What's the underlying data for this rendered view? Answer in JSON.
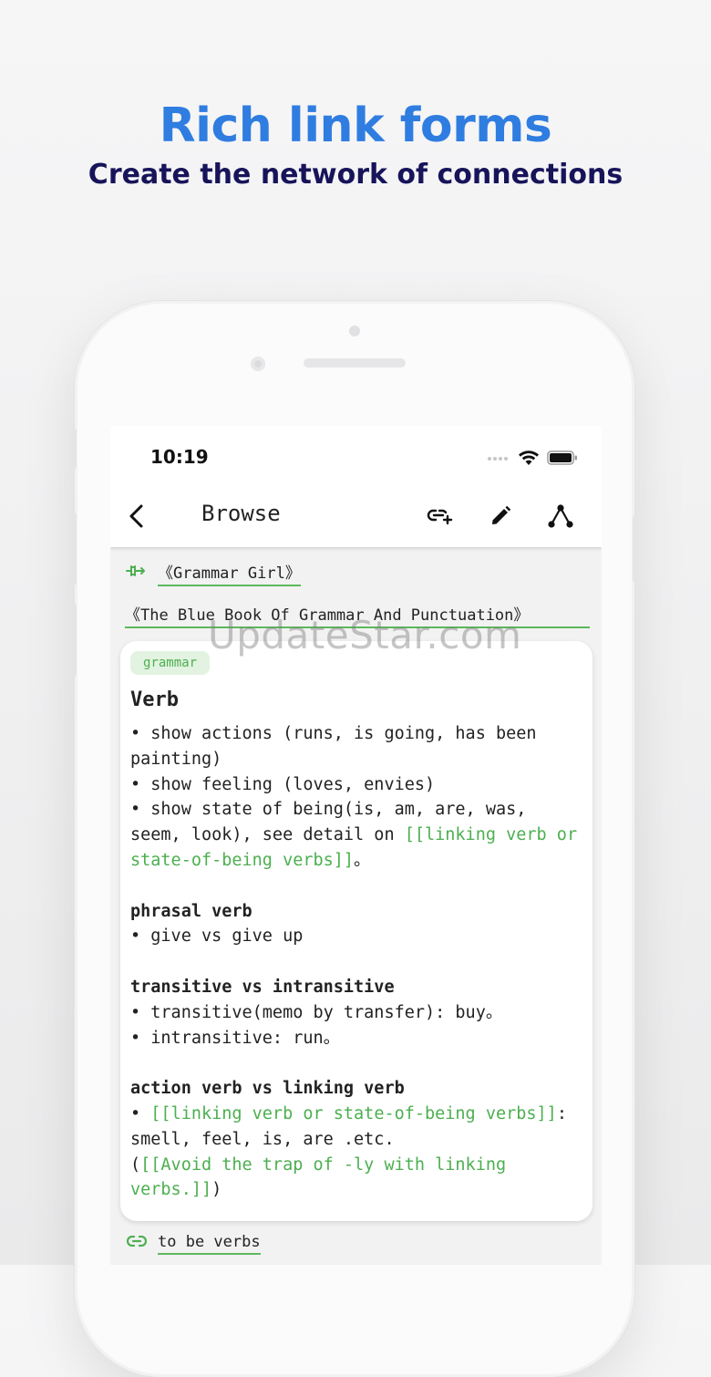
{
  "promo": {
    "title": "Rich link forms",
    "subtitle": "Create the network of connections"
  },
  "status_bar": {
    "time": "10:19"
  },
  "topbar": {
    "title": "Browse"
  },
  "links": {
    "source": "《Grammar Girl》",
    "reference": "《The Blue Book Of Grammar And Punctuation》",
    "bottom": "to be verbs"
  },
  "note": {
    "tag": "grammar",
    "heading": "Verb",
    "bullet1": "• show actions (runs, is going, has been painting)",
    "bullet2": "• show feeling (loves, envies)",
    "bullet3_prefix": "• show state of being(is, am, are, was, seem, look), see detail on ",
    "bullet3_link": "[[linking verb or state-of-being verbs]]",
    "bullet3_suffix": "。",
    "h_phrasal": "phrasal verb",
    "phrasal_item": "• give vs give up",
    "h_transitive": "transitive vs intransitive",
    "transitive_item": "• transitive(memo by transfer): buy。",
    "intransitive_item": "• intransitive: run。",
    "h_action": "action verb vs linking verb",
    "action_bullet": "• ",
    "action_link1": "[[linking verb or state-of-being verbs]]",
    "action_text": ": smell, feel, is, are .etc.",
    "action_open": "(",
    "action_link2": "[[Avoid the trap of -ly with linking verbs.]]",
    "action_close": ")"
  },
  "watermark": "UpdateStar.com",
  "colors": {
    "accent_blue": "#2f7de0",
    "navy": "#17145a",
    "link_green": "#4caf50"
  },
  "icons": [
    "back-arrow-icon",
    "add-link-icon",
    "pencil-icon",
    "graph-icon",
    "wifi-icon",
    "battery-icon",
    "signal-icon",
    "backlink-icon",
    "link-icon"
  ]
}
